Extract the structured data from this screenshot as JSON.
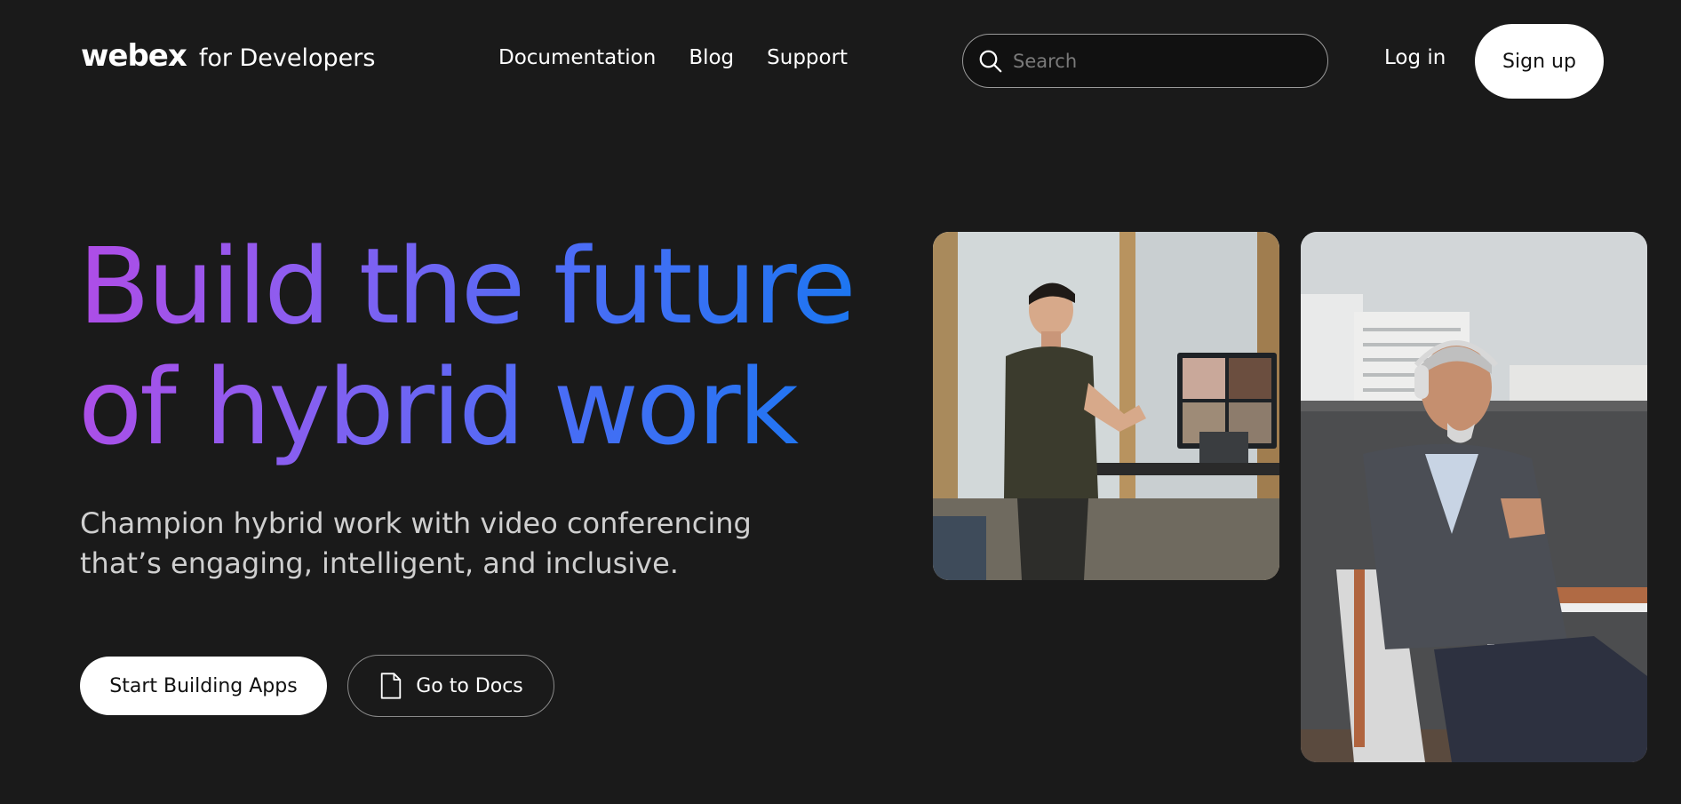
{
  "header": {
    "logo_word": "webex",
    "logo_sub": "for Developers",
    "nav": [
      "Documentation",
      "Blog",
      "Support"
    ],
    "search_placeholder": "Search",
    "login_label": "Log in",
    "signup_label": "Sign up"
  },
  "hero": {
    "headline_line1": "Build the future",
    "headline_line2": "of hybrid work",
    "subtext_line1": "Champion hybrid work with video conferencing",
    "subtext_line2": "that’s engaging, intelligent, and inclusive.",
    "primary_cta": "Start Building Apps",
    "secondary_cta": "Go to Docs"
  },
  "icons": {
    "search": "search-icon",
    "docs": "document-icon"
  },
  "colors": {
    "background": "#1a1a1a",
    "gradient_start": "#b04ce6",
    "gradient_end": "#1877f0",
    "button_bg": "#ffffff"
  }
}
